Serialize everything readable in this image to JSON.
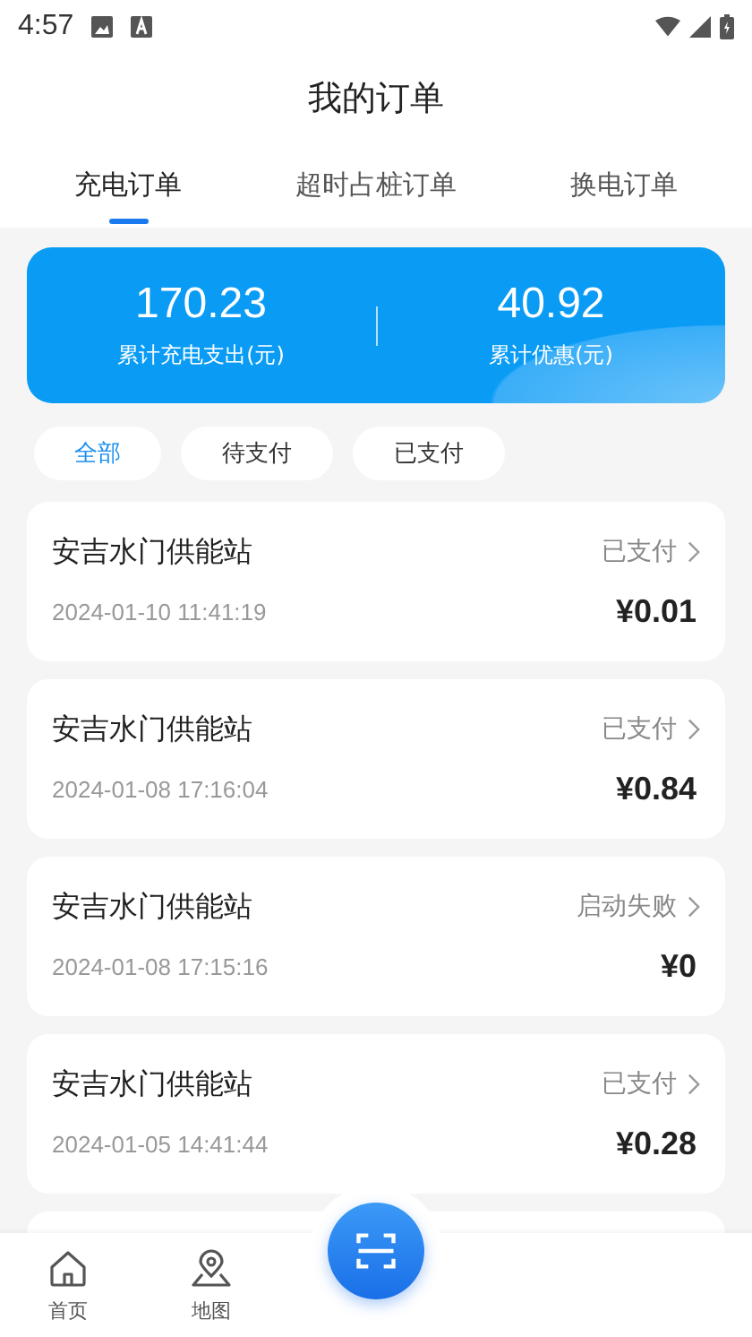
{
  "status_bar": {
    "time": "4:57"
  },
  "title": "我的订单",
  "tabs": [
    {
      "label": "充电订单",
      "selected": true
    },
    {
      "label": "超时占桩订单",
      "selected": false
    },
    {
      "label": "换电订单",
      "selected": false
    }
  ],
  "summary": [
    {
      "value": "170.23",
      "label": "累计充电支出(元)"
    },
    {
      "value": "40.92",
      "label": "累计优惠(元)"
    }
  ],
  "filters": [
    {
      "label": "全部",
      "selected": true
    },
    {
      "label": "待支付",
      "selected": false
    },
    {
      "label": "已支付",
      "selected": false
    }
  ],
  "orders": [
    {
      "station": "安吉水门供能站",
      "status": "已支付",
      "time": "2024-01-10 11:41:19",
      "amount": "¥0.01"
    },
    {
      "station": "安吉水门供能站",
      "status": "已支付",
      "time": "2024-01-08 17:16:04",
      "amount": "¥0.84"
    },
    {
      "station": "安吉水门供能站",
      "status": "启动失败",
      "time": "2024-01-08 17:15:16",
      "amount": "¥0"
    },
    {
      "station": "安吉水门供能站",
      "status": "已支付",
      "time": "2024-01-05 14:41:44",
      "amount": "¥0.28"
    }
  ],
  "nav": [
    {
      "label": "首页",
      "kind": "home"
    },
    {
      "label": "地图",
      "kind": "map"
    }
  ]
}
